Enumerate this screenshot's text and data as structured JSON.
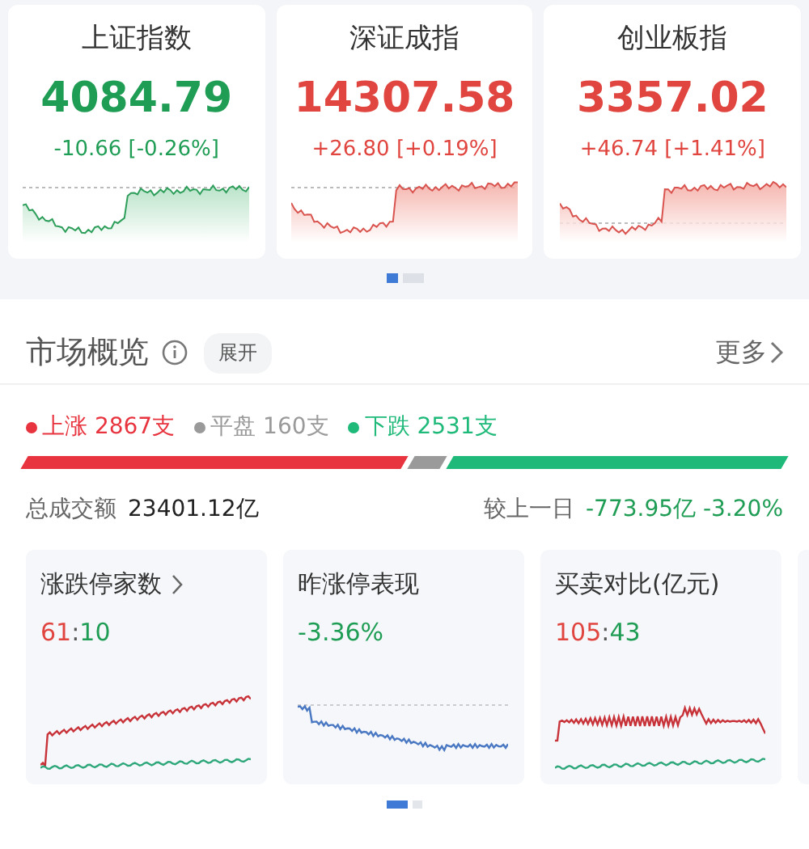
{
  "indices": [
    {
      "name": "上证指数",
      "value": "4084.79",
      "change": "-10.66 [-0.26%]",
      "rising": false
    },
    {
      "name": "深证成指",
      "value": "14307.58",
      "change": "+26.80 [+0.19%]",
      "rising": true
    },
    {
      "name": "创业板指",
      "value": "3357.02",
      "change": "+46.74 [+1.41%]",
      "rising": true
    }
  ],
  "index_pages": [
    {
      "selected": true
    },
    {
      "selected": false
    }
  ],
  "overview": {
    "title": "市场概览",
    "expand_button": "展开",
    "more_link": "更多",
    "breadth": [
      {
        "label": "上涨",
        "count": "2867支",
        "color": "#e8343f"
      },
      {
        "label": "平盘",
        "count": "160支",
        "color": "#9a9a9a"
      },
      {
        "label": "下跌",
        "count": "2531支",
        "color": "#1fb97a"
      }
    ],
    "turnover": {
      "label": "总成交额",
      "value": "23401.12亿",
      "compare_label": "较上一日",
      "compare_value": "-773.95亿 -3.20%"
    }
  },
  "panels": [
    {
      "title": "涨跌停家数",
      "has_arrow": true,
      "kind": "ratio",
      "up": "61",
      "separator": ":",
      "down": "10"
    },
    {
      "title": "昨涨停表现",
      "has_arrow": false,
      "kind": "percent",
      "value": "-3.36%"
    },
    {
      "title": "买卖对比(亿元)",
      "has_arrow": false,
      "kind": "ratio",
      "up": "105",
      "separator": ":",
      "down": "43"
    }
  ],
  "panel_pages": [
    {
      "selected": true
    },
    {
      "selected": false
    }
  ]
}
